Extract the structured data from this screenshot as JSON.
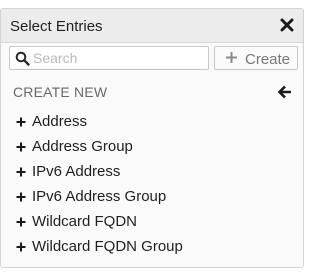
{
  "dialog": {
    "title": "Select Entries",
    "close_icon": "close-icon"
  },
  "search": {
    "placeholder": "Search",
    "value": "",
    "icon": "search-icon"
  },
  "create_button": {
    "label": "Create",
    "icon": "plus-icon"
  },
  "section": {
    "title": "CREATE NEW",
    "back_icon": "arrow-left-icon"
  },
  "items": [
    {
      "label": "Address",
      "icon": "plus-icon"
    },
    {
      "label": "Address Group",
      "icon": "plus-icon"
    },
    {
      "label": "IPv6 Address",
      "icon": "plus-icon"
    },
    {
      "label": "IPv6 Address Group",
      "icon": "plus-icon"
    },
    {
      "label": "Wildcard FQDN",
      "icon": "plus-icon"
    },
    {
      "label": "Wildcard FQDN Group",
      "icon": "plus-icon"
    }
  ],
  "colors": {
    "header_bg": "#ececec",
    "panel_bg": "#fafafa",
    "border": "#d4d4d4",
    "muted_text": "#777777"
  }
}
